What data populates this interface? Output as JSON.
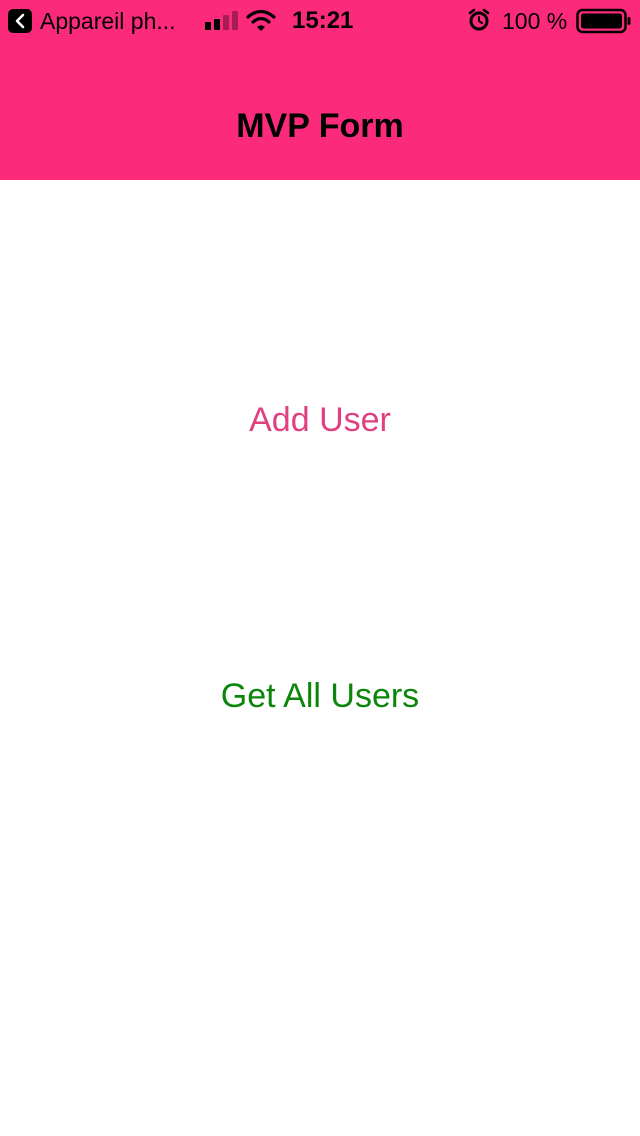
{
  "theme": {
    "header_bg": "#FC2A7B",
    "add_user_color": "#E0407F",
    "get_users_color": "#0B860B"
  },
  "status_bar": {
    "back_app_label": "Appareil ph...",
    "time": "15:21",
    "battery_percent": "100 %",
    "icons": [
      "back-chevron-icon",
      "signal-icon",
      "wifi-icon",
      "alarm-icon",
      "battery-icon"
    ]
  },
  "nav": {
    "title": "MVP Form"
  },
  "main": {
    "add_user_label": "Add User",
    "get_all_users_label": "Get All Users"
  }
}
